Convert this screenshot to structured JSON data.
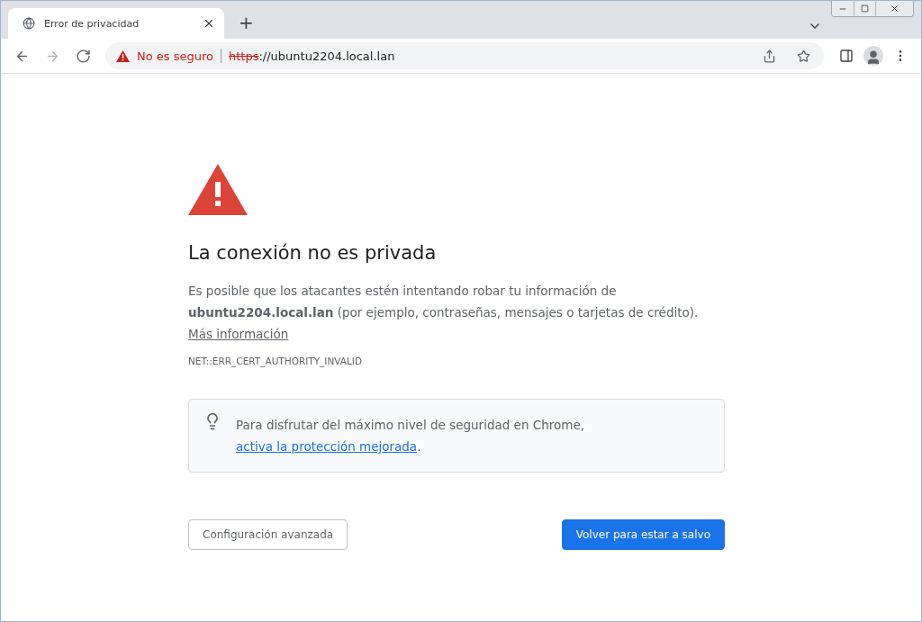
{
  "tab": {
    "title": "Error de privacidad",
    "selected": true
  },
  "new_tab_label": "+",
  "address_bar": {
    "security_label": "No es seguro",
    "scheme": "https",
    "rest": "://ubuntu2204.local.lan"
  },
  "page": {
    "heading": "La conexión no es privada",
    "description": "Es posible que los atacantes estén intentando robar tu información de **ubuntu2204.local.lan** (por ejemplo, contraseñas, mensajes o tarjetas de crédito).",
    "more_link": "Más información",
    "error_code": "NET::ERR_CERT_AUTHORITY_INVALID",
    "tip": {
      "text": "Para disfrutar del máximo nivel de seguridad en Chrome,",
      "link": "activa la protección mejorada",
      "suffix": "."
    },
    "buttons": [
      {
        "label": "Configuración avanzada",
        "kind": "secondary"
      },
      {
        "label": "Volver para estar a salvo",
        "kind": "primary"
      }
    ]
  }
}
